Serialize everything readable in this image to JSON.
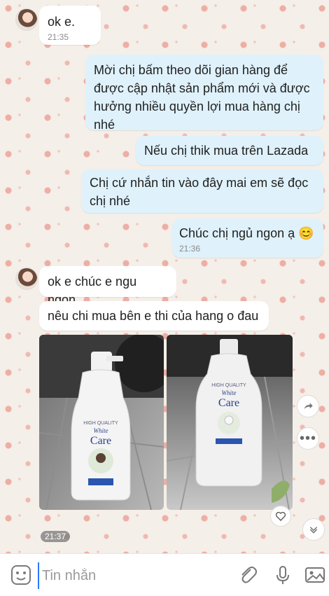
{
  "messages": [
    {
      "text": "ok e.",
      "time": "21:35"
    },
    {
      "text": "Mời chị bấm theo dõi gian hàng để được cập nhật sản phẩm mới và được hưởng nhiều quyền lợi mua hàng chị nhé"
    },
    {
      "text": "Nếu chị thik mua trên Lazada"
    },
    {
      "text": "Chị cứ nhắn tin vào đây mai em sẽ đọc chị nhé"
    },
    {
      "text": "Chúc chị ngủ ngon ạ 😊",
      "time": "21:36"
    },
    {
      "text": "ok e chúc e ngu ngon"
    },
    {
      "text": "nêu chi mua bên e thi của hang o đau"
    }
  ],
  "photos": {
    "time": "21:37",
    "left_label": {
      "brand_top": "HIGH QUALITY",
      "brand": "White",
      "brand2": "Care"
    },
    "right_label": {
      "brand_top": "HIGH QUALITY",
      "brand": "White",
      "brand2": "Care"
    }
  },
  "compose": {
    "placeholder": "Tin nhắn"
  },
  "colors": {
    "incoming": "#ffffff",
    "outgoing": "#dff1fb",
    "accent": "#2a78ff"
  }
}
